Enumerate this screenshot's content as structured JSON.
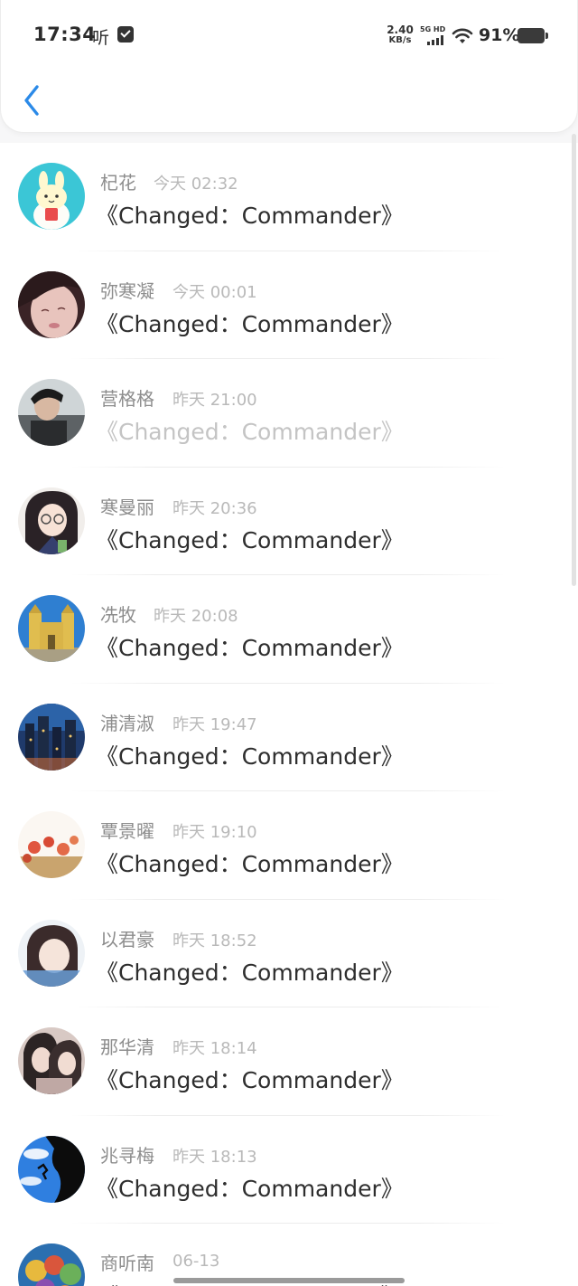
{
  "status_bar": {
    "time": "17:34",
    "app_char": "听",
    "net_speed_value": "2.40",
    "net_speed_unit": "KB/s",
    "signal_label": "5G HD",
    "battery": "91%"
  },
  "nav": {
    "back_icon": "chevron-left-icon"
  },
  "colors": {
    "accent": "#2b8ae8",
    "name": "#8d8d8d",
    "time": "#b9b9b9",
    "title": "#2e2e2e",
    "title_read": "#c4c4c4"
  },
  "items": [
    {
      "name": "杞花",
      "time": "今天 02:32",
      "title": "《Changed：Commander》",
      "read": false
    },
    {
      "name": "弥寒凝",
      "time": "今天 00:01",
      "title": "《Changed：Commander》",
      "read": false
    },
    {
      "name": "营格格",
      "time": "昨天 21:00",
      "title": "《Changed：Commander》",
      "read": true
    },
    {
      "name": "寒曼丽",
      "time": "昨天 20:36",
      "title": "《Changed：Commander》",
      "read": false
    },
    {
      "name": "冼牧",
      "time": "昨天 20:08",
      "title": "《Changed：Commander》",
      "read": false
    },
    {
      "name": "浦清淑",
      "time": "昨天 19:47",
      "title": "《Changed：Commander》",
      "read": false
    },
    {
      "name": "覃景曜",
      "time": "昨天 19:10",
      "title": "《Changed：Commander》",
      "read": false
    },
    {
      "name": "以君豪",
      "time": "昨天 18:52",
      "title": "《Changed：Commander》",
      "read": false
    },
    {
      "name": "那华清",
      "time": "昨天 18:14",
      "title": "《Changed：Commander》",
      "read": false
    },
    {
      "name": "兆寻梅",
      "time": "昨天 18:13",
      "title": "《Changed：Commander》",
      "read": false
    },
    {
      "name": "商听南",
      "time": "06-13",
      "title": "《Changed：Commander》",
      "read": false
    }
  ]
}
